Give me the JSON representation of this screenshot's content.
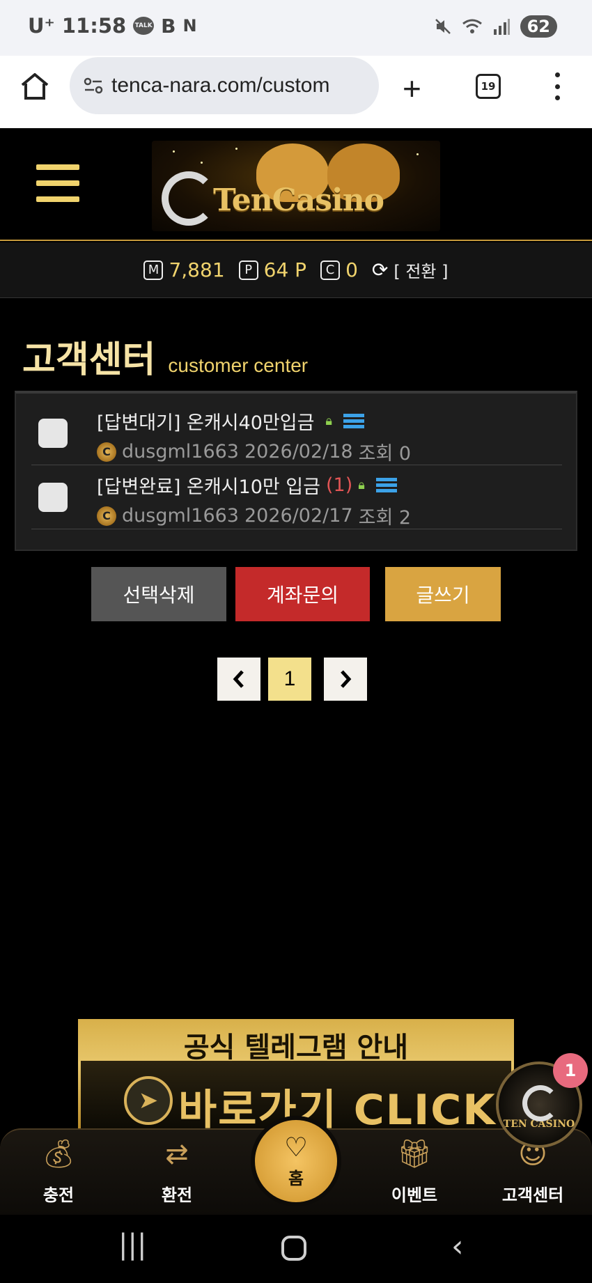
{
  "status_bar": {
    "carrier": "U⁺",
    "time": "11:58",
    "battery": "62",
    "icons": [
      "kakaotalk-icon",
      "b-icon",
      "n-icon",
      "mute-icon",
      "wifi-icon",
      "signal-icon",
      "battery-icon"
    ]
  },
  "browser": {
    "url": "tenca-nara.com/custom",
    "tab_count": "19"
  },
  "header": {
    "logo_text": "TenCasino"
  },
  "balance": {
    "money_icon": "M",
    "money": "7,881",
    "point_icon": "P",
    "points": "64 P",
    "coin_icon": "C",
    "coins": "0",
    "switch_label": "[ 전환 ]"
  },
  "page": {
    "title_ko": "고객센터",
    "title_en": "customer center"
  },
  "posts": [
    {
      "title": "[답변대기] 온캐시40만입금",
      "reply_count": "",
      "author": "dusgml1663",
      "date": "2026/02/18",
      "views": "조회 0"
    },
    {
      "title": "[답변완료] 온캐시10만 입금",
      "reply_count": "(1)",
      "author": "dusgml1663",
      "date": "2026/02/17",
      "views": "조회 2"
    }
  ],
  "actions": {
    "delete_selected": "선택삭제",
    "account_inquiry": "계좌문의",
    "write": "글쓰기"
  },
  "pagination": {
    "current_page": "1"
  },
  "telegram_banner": {
    "heading": "공식 텔레그램 안내",
    "cta": "바로가기 CLICK"
  },
  "floating_chat": {
    "logo_text": "TEN CASINO",
    "badge_count": "1"
  },
  "bottom_nav": {
    "charge": "충전",
    "exchange": "환전",
    "home": "홈",
    "event": "이벤트",
    "customer_center": "고객센터"
  },
  "colors": {
    "gold": "#f0d36d",
    "red": "#c42a2a",
    "gray_button": "#555555",
    "write_button": "#d9a441",
    "background": "#000000"
  }
}
